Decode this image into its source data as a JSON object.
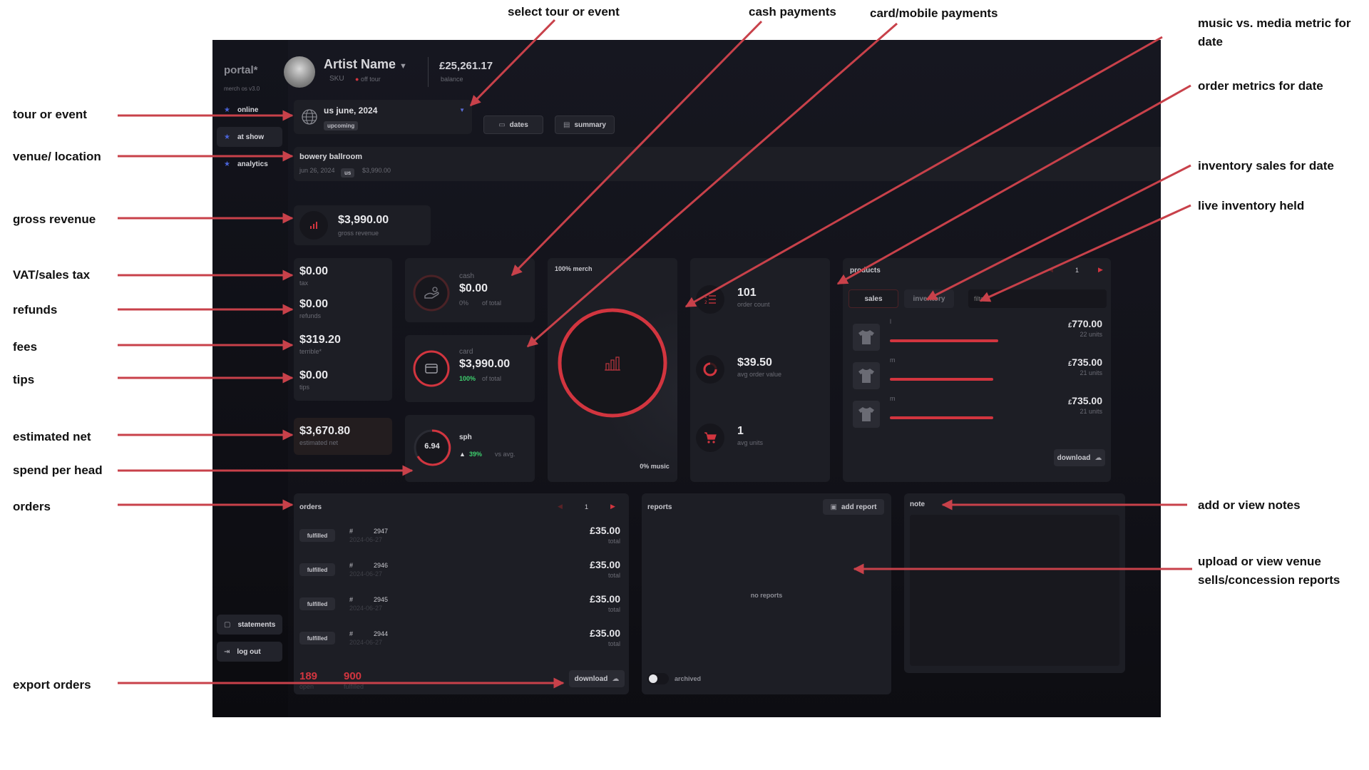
{
  "annotations": {
    "left": {
      "tour_or_event": "tour or event",
      "venue_location": "venue/ location",
      "gross_revenue": "gross revenue",
      "vat": "VAT/sales tax",
      "refunds": "refunds",
      "fees": "fees",
      "tips": "tips",
      "estimated_net": "estimated net",
      "spend_per_head": "spend per head",
      "orders": "orders",
      "export_orders": "export orders"
    },
    "top": {
      "select_tour": "select tour or event",
      "cash_payments": "cash payments",
      "card_payments": "card/mobile payments"
    },
    "right": {
      "music_media_line1": "music vs. media metric for",
      "music_media_line2": "date",
      "order_metrics": "order metrics for date",
      "inventory_sales": "inventory sales for date",
      "live_inventory": "live inventory held",
      "notes": "add or view notes",
      "upload_reports_line1": "upload or view venue",
      "upload_reports_line2": "sells/concession reports"
    }
  },
  "app": {
    "logo": "portal*",
    "version": "merch os v3.0",
    "nav": [
      {
        "label": "online",
        "icon": "star-icon"
      },
      {
        "label": "at show",
        "icon": "star-icon"
      },
      {
        "label": "analytics",
        "icon": "star-icon"
      }
    ],
    "footer_nav": [
      {
        "label": "statements",
        "icon": "document-icon"
      },
      {
        "label": "log out",
        "icon": "logout-icon"
      }
    ],
    "artist": {
      "name": "Artist Name",
      "sku": "SKU",
      "status": "off tour"
    },
    "balance": {
      "value": "£25,261.17",
      "label": "balance"
    },
    "tour": {
      "name": "us june, 2024",
      "badge": "upcoming"
    },
    "buttons": {
      "dates": "dates",
      "summary": "summary"
    },
    "venue": {
      "name": "bowery ballroom",
      "date": "jun 26, 2024",
      "country": "us",
      "amount": "$3,990.00"
    },
    "gross": {
      "value": "$3,990.00",
      "label": "gross revenue"
    },
    "breakdown": [
      {
        "value": "$0.00",
        "label": "tax"
      },
      {
        "value": "$0.00",
        "label": "refunds"
      },
      {
        "value": "$319.20",
        "label": "terrible*"
      },
      {
        "value": "$0.00",
        "label": "tips"
      }
    ],
    "net": {
      "value": "$3,670.80",
      "label": "estimated net"
    },
    "cash": {
      "label": "cash",
      "value": "$0.00",
      "pct": "0%",
      "pct_label": "of total"
    },
    "card": {
      "label": "card",
      "value": "$3,990.00",
      "pct": "100%",
      "pct_label": "of total"
    },
    "sph": {
      "value": "6.94",
      "label": "sph",
      "change": "39%",
      "change_label": "vs avg."
    },
    "mix": {
      "merch": "100% merch",
      "music": "0% music",
      "merch_fraction": 1.0
    },
    "metrics": [
      {
        "value": "101",
        "label": "order count",
        "icon": "list-icon"
      },
      {
        "value": "$39.50",
        "label": "avg order value",
        "icon": "donut-icon"
      },
      {
        "value": "1",
        "label": "avg units",
        "icon": "cart-icon"
      }
    ],
    "products": {
      "title": "products",
      "page": "1",
      "tabs": [
        "sales",
        "inventory"
      ],
      "filter_placeholder": "filter...",
      "items": [
        {
          "size": "l",
          "price": "770.00",
          "units": "22 units",
          "fraction": 1.0
        },
        {
          "size": "m",
          "price": "735.00",
          "units": "21 units",
          "fraction": 0.955
        },
        {
          "size": "m",
          "price": "735.00",
          "units": "21 units",
          "fraction": 0.955
        }
      ],
      "currency": "£",
      "download": "download"
    },
    "orders": {
      "title": "orders",
      "page": "1",
      "rows": [
        {
          "status": "fulfilled",
          "hash": "#",
          "number": "2947",
          "date": "2024-06-27",
          "amount": "£35.00",
          "amount_label": "total"
        },
        {
          "status": "fulfilled",
          "hash": "#",
          "number": "2946",
          "date": "2024-06-27",
          "amount": "£35.00",
          "amount_label": "total"
        },
        {
          "status": "fulfilled",
          "hash": "#",
          "number": "2945",
          "date": "2024-06-27",
          "amount": "£35.00",
          "amount_label": "total"
        },
        {
          "status": "fulfilled",
          "hash": "#",
          "number": "2944",
          "date": "2024-06-27",
          "amount": "£35.00",
          "amount_label": "total"
        }
      ],
      "open_count": "189",
      "open_label": "open",
      "fulfilled_count": "900",
      "fulfilled_label": "fulfilled",
      "download": "download"
    },
    "reports": {
      "title": "reports",
      "add": "add report",
      "empty": "no reports",
      "archived": "archived"
    },
    "note": {
      "title": "note"
    },
    "colors": {
      "accent": "#d2353f",
      "green": "#3ecf6e",
      "panel": "#1d1e25"
    }
  }
}
